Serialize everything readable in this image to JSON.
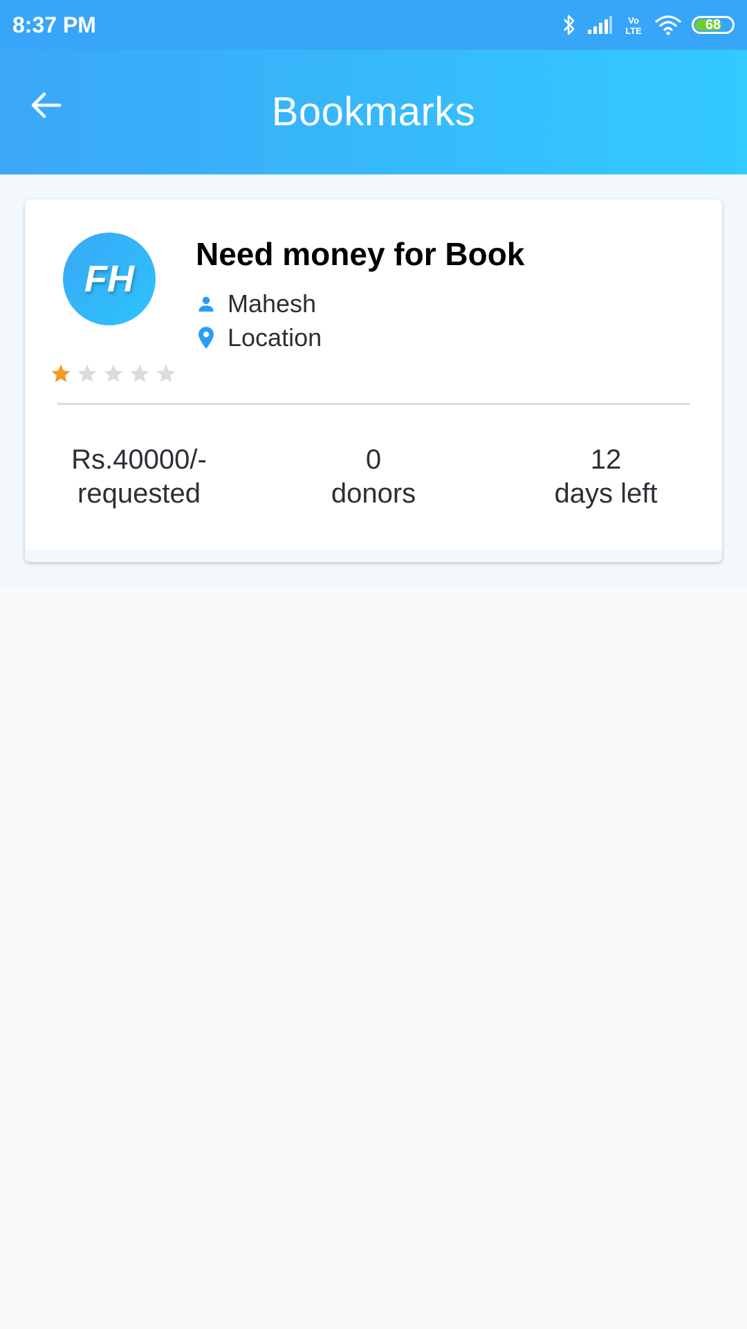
{
  "status_bar": {
    "time": "8:37 PM",
    "network_label": "Vo LTE",
    "battery_level": "68"
  },
  "app_bar": {
    "title": "Bookmarks"
  },
  "bookmark": {
    "avatar_text": "FH",
    "title": "Need money for Book",
    "user_name": "Mahesh",
    "location": "Location",
    "rating": 1,
    "rating_max": 5,
    "stats": {
      "amount_value": "Rs.40000/-",
      "amount_label": "requested",
      "donors_value": "0",
      "donors_label": "donors",
      "days_value": "12",
      "days_label": "days left"
    }
  },
  "colors": {
    "primary": "#38a6f8",
    "star_filled": "#f39a1f",
    "star_empty": "#dcdcdc",
    "icon_accent": "#2a9df4"
  }
}
